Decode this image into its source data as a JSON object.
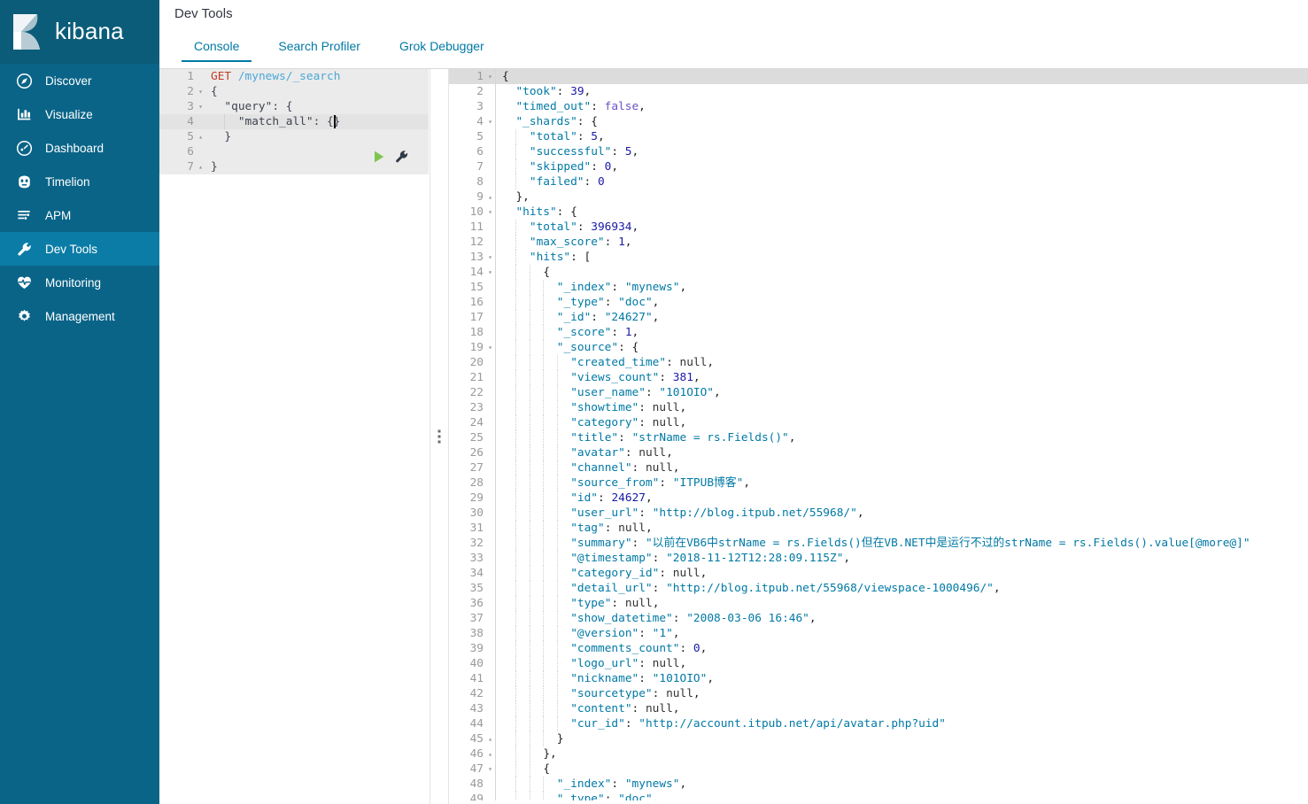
{
  "brand": {
    "name": "kibana",
    "logo_icon": "kibana-logo-icon"
  },
  "sidebar": {
    "items": [
      {
        "label": "Discover",
        "icon": "compass-icon",
        "active": false
      },
      {
        "label": "Visualize",
        "icon": "bar-chart-icon",
        "active": false
      },
      {
        "label": "Dashboard",
        "icon": "dashboard-icon",
        "active": false
      },
      {
        "label": "Timelion",
        "icon": "timelion-icon",
        "active": false
      },
      {
        "label": "APM",
        "icon": "apm-icon",
        "active": false
      },
      {
        "label": "Dev Tools",
        "icon": "wrench-icon",
        "active": true
      },
      {
        "label": "Monitoring",
        "icon": "heartbeat-icon",
        "active": false
      },
      {
        "label": "Management",
        "icon": "gear-icon",
        "active": false
      }
    ]
  },
  "header": {
    "title": "Dev Tools",
    "tabs": [
      {
        "label": "Console",
        "active": true
      },
      {
        "label": "Search Profiler",
        "active": false
      },
      {
        "label": "Grok Debugger",
        "active": false
      }
    ]
  },
  "editor": {
    "run_icon": "play-icon",
    "settings_icon": "wrench-icon",
    "method": "GET",
    "path": "/mynews/_search",
    "lines": [
      {
        "num": "1",
        "fold": "",
        "text": "",
        "kind": "request",
        "shaded": true,
        "cursor": false
      },
      {
        "num": "2",
        "fold": "▾",
        "text": "{",
        "kind": "plain",
        "shaded": true,
        "cursor": false
      },
      {
        "num": "3",
        "fold": "▾",
        "text": "  \"query\": {",
        "kind": "plain",
        "shaded": true,
        "cursor": false
      },
      {
        "num": "4",
        "fold": "",
        "text": "    \"match_all\": {}",
        "kind": "plain",
        "shaded": true,
        "cursor": true
      },
      {
        "num": "5",
        "fold": "▴",
        "text": "  }",
        "kind": "plain",
        "shaded": true,
        "cursor": false
      },
      {
        "num": "6",
        "fold": "",
        "text": "",
        "kind": "plain",
        "shaded": true,
        "cursor": false
      },
      {
        "num": "7",
        "fold": "▴",
        "text": "}",
        "kind": "plain",
        "shaded": true,
        "cursor": false
      }
    ]
  },
  "response": {
    "lines": [
      {
        "num": "1",
        "fold": "▾",
        "indent": 0,
        "hl": true,
        "text": "{"
      },
      {
        "num": "2",
        "fold": "",
        "indent": 1,
        "hl": false,
        "text": "  \"took\": 39,"
      },
      {
        "num": "3",
        "fold": "",
        "indent": 1,
        "hl": false,
        "text": "  \"timed_out\": false,"
      },
      {
        "num": "4",
        "fold": "▾",
        "indent": 1,
        "hl": false,
        "text": "  \"_shards\": {"
      },
      {
        "num": "5",
        "fold": "",
        "indent": 2,
        "hl": false,
        "text": "    \"total\": 5,"
      },
      {
        "num": "6",
        "fold": "",
        "indent": 2,
        "hl": false,
        "text": "    \"successful\": 5,"
      },
      {
        "num": "7",
        "fold": "",
        "indent": 2,
        "hl": false,
        "text": "    \"skipped\": 0,"
      },
      {
        "num": "8",
        "fold": "",
        "indent": 2,
        "hl": false,
        "text": "    \"failed\": 0"
      },
      {
        "num": "9",
        "fold": "▴",
        "indent": 1,
        "hl": false,
        "text": "  },"
      },
      {
        "num": "10",
        "fold": "▾",
        "indent": 1,
        "hl": false,
        "text": "  \"hits\": {"
      },
      {
        "num": "11",
        "fold": "",
        "indent": 2,
        "hl": false,
        "text": "    \"total\": 396934,"
      },
      {
        "num": "12",
        "fold": "",
        "indent": 2,
        "hl": false,
        "text": "    \"max_score\": 1,"
      },
      {
        "num": "13",
        "fold": "▾",
        "indent": 2,
        "hl": false,
        "text": "    \"hits\": ["
      },
      {
        "num": "14",
        "fold": "▾",
        "indent": 3,
        "hl": false,
        "text": "      {"
      },
      {
        "num": "15",
        "fold": "",
        "indent": 4,
        "hl": false,
        "text": "        \"_index\": \"mynews\","
      },
      {
        "num": "16",
        "fold": "",
        "indent": 4,
        "hl": false,
        "text": "        \"_type\": \"doc\","
      },
      {
        "num": "17",
        "fold": "",
        "indent": 4,
        "hl": false,
        "text": "        \"_id\": \"24627\","
      },
      {
        "num": "18",
        "fold": "",
        "indent": 4,
        "hl": false,
        "text": "        \"_score\": 1,"
      },
      {
        "num": "19",
        "fold": "▾",
        "indent": 4,
        "hl": false,
        "text": "        \"_source\": {"
      },
      {
        "num": "20",
        "fold": "",
        "indent": 5,
        "hl": false,
        "text": "          \"created_time\": null,"
      },
      {
        "num": "21",
        "fold": "",
        "indent": 5,
        "hl": false,
        "text": "          \"views_count\": 381,"
      },
      {
        "num": "22",
        "fold": "",
        "indent": 5,
        "hl": false,
        "text": "          \"user_name\": \"101OIO\","
      },
      {
        "num": "23",
        "fold": "",
        "indent": 5,
        "hl": false,
        "text": "          \"showtime\": null,"
      },
      {
        "num": "24",
        "fold": "",
        "indent": 5,
        "hl": false,
        "text": "          \"category\": null,"
      },
      {
        "num": "25",
        "fold": "",
        "indent": 5,
        "hl": false,
        "text": "          \"title\": \"strName = rs.Fields()\","
      },
      {
        "num": "26",
        "fold": "",
        "indent": 5,
        "hl": false,
        "text": "          \"avatar\": null,"
      },
      {
        "num": "27",
        "fold": "",
        "indent": 5,
        "hl": false,
        "text": "          \"channel\": null,"
      },
      {
        "num": "28",
        "fold": "",
        "indent": 5,
        "hl": false,
        "text": "          \"source_from\": \"ITPUB博客\","
      },
      {
        "num": "29",
        "fold": "",
        "indent": 5,
        "hl": false,
        "text": "          \"id\": 24627,"
      },
      {
        "num": "30",
        "fold": "",
        "indent": 5,
        "hl": false,
        "text": "          \"user_url\": \"http://blog.itpub.net/55968/\","
      },
      {
        "num": "31",
        "fold": "",
        "indent": 5,
        "hl": false,
        "text": "          \"tag\": null,"
      },
      {
        "num": "32",
        "fold": "",
        "indent": 5,
        "hl": false,
        "text": "          \"summary\": \"以前在VB6中strName = rs.Fields()但在VB.NET中是运行不过的strName = rs.Fields().value[@more@]\""
      },
      {
        "num": "33",
        "fold": "",
        "indent": 5,
        "hl": false,
        "text": "          \"@timestamp\": \"2018-11-12T12:28:09.115Z\","
      },
      {
        "num": "34",
        "fold": "",
        "indent": 5,
        "hl": false,
        "text": "          \"category_id\": null,"
      },
      {
        "num": "35",
        "fold": "",
        "indent": 5,
        "hl": false,
        "text": "          \"detail_url\": \"http://blog.itpub.net/55968/viewspace-1000496/\","
      },
      {
        "num": "36",
        "fold": "",
        "indent": 5,
        "hl": false,
        "text": "          \"type\": null,"
      },
      {
        "num": "37",
        "fold": "",
        "indent": 5,
        "hl": false,
        "text": "          \"show_datetime\": \"2008-03-06 16:46\","
      },
      {
        "num": "38",
        "fold": "",
        "indent": 5,
        "hl": false,
        "text": "          \"@version\": \"1\","
      },
      {
        "num": "39",
        "fold": "",
        "indent": 5,
        "hl": false,
        "text": "          \"comments_count\": 0,"
      },
      {
        "num": "40",
        "fold": "",
        "indent": 5,
        "hl": false,
        "text": "          \"logo_url\": null,"
      },
      {
        "num": "41",
        "fold": "",
        "indent": 5,
        "hl": false,
        "text": "          \"nickname\": \"101OIO\","
      },
      {
        "num": "42",
        "fold": "",
        "indent": 5,
        "hl": false,
        "text": "          \"sourcetype\": null,"
      },
      {
        "num": "43",
        "fold": "",
        "indent": 5,
        "hl": false,
        "text": "          \"content\": null,"
      },
      {
        "num": "44",
        "fold": "",
        "indent": 5,
        "hl": false,
        "text": "          \"cur_id\": \"http://account.itpub.net/api/avatar.php?uid\""
      },
      {
        "num": "45",
        "fold": "▴",
        "indent": 4,
        "hl": false,
        "text": "        }"
      },
      {
        "num": "46",
        "fold": "▴",
        "indent": 3,
        "hl": false,
        "text": "      },"
      },
      {
        "num": "47",
        "fold": "▾",
        "indent": 3,
        "hl": false,
        "text": "      {"
      },
      {
        "num": "48",
        "fold": "",
        "indent": 4,
        "hl": false,
        "text": "        \"_index\": \"mynews\","
      },
      {
        "num": "49",
        "fold": "",
        "indent": 4,
        "hl": false,
        "text": "        \"_type\": \"doc\","
      }
    ]
  },
  "colors": {
    "sidebar_bg": "#0a6488",
    "sidebar_active": "#0b7ca6",
    "brand_bg": "#0b5c78",
    "accent": "#0079a5",
    "method": "#c23b22",
    "number": "#1a1aa6",
    "boolean": "#6b53c4"
  }
}
